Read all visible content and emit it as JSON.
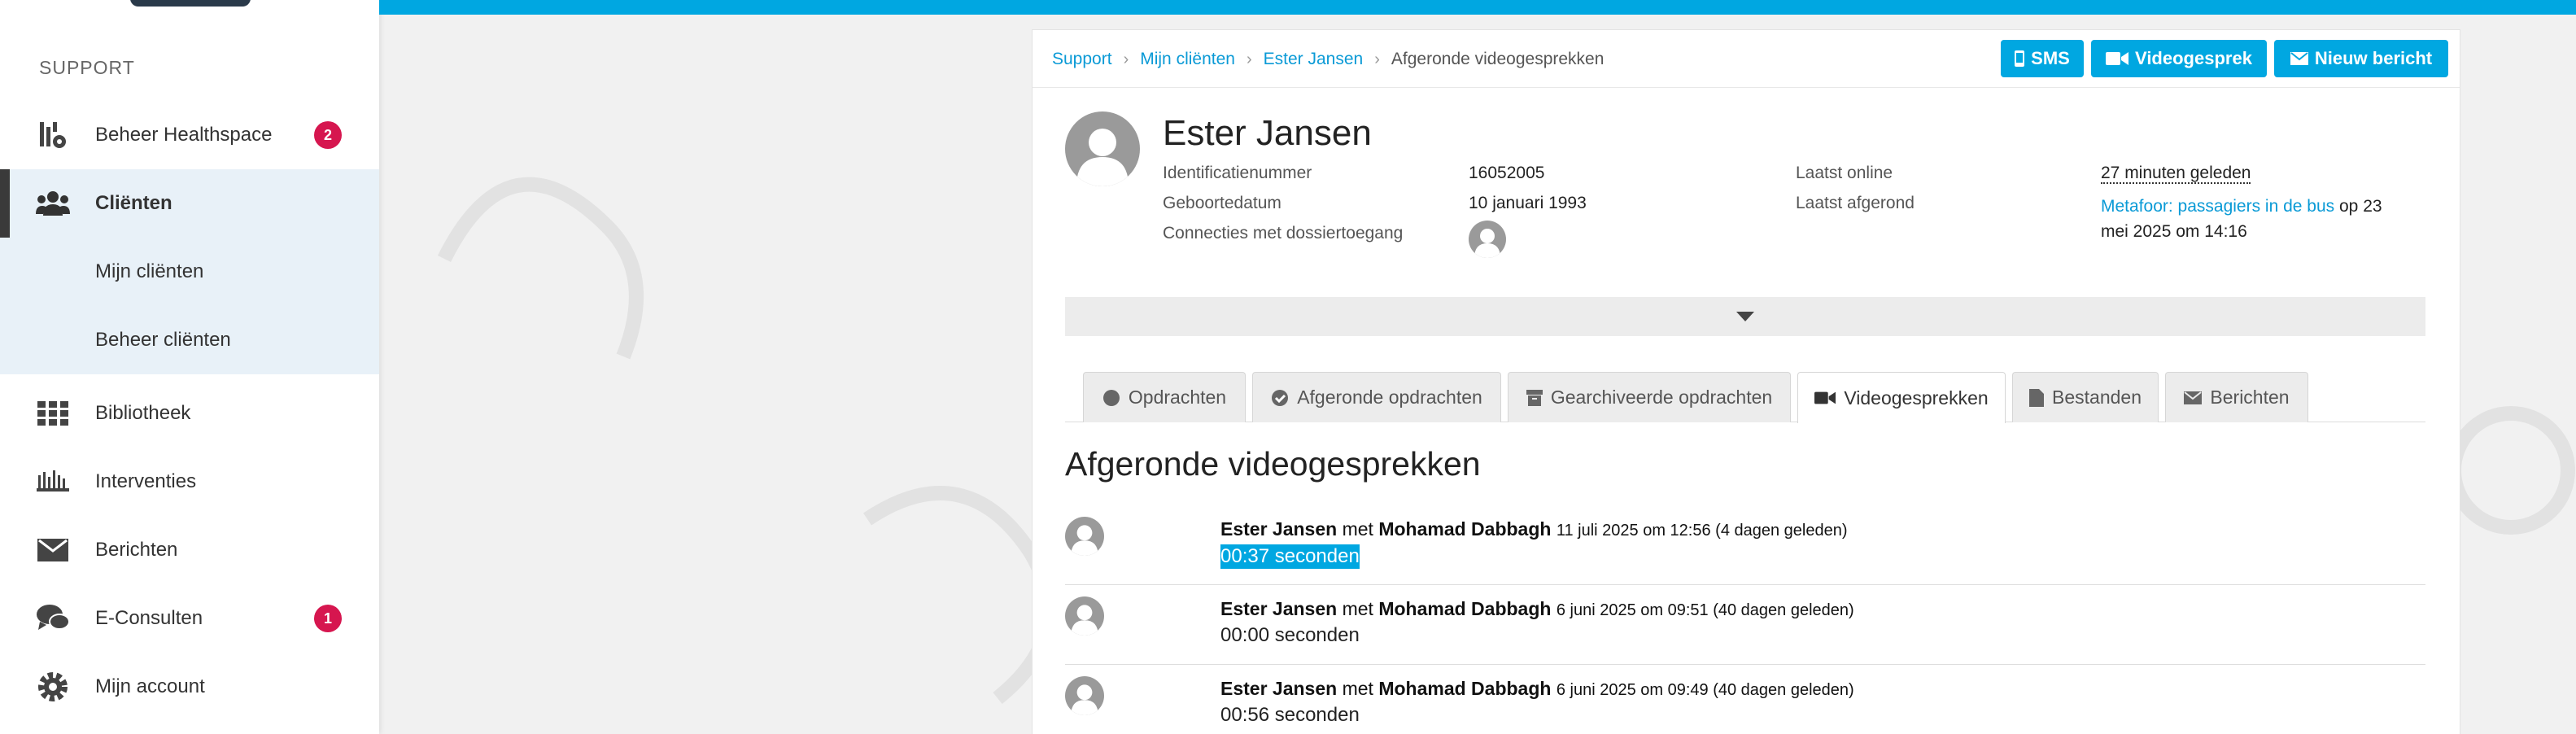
{
  "sidebar": {
    "heading": "SUPPORT",
    "items": [
      {
        "label": "Beheer Healthspace",
        "badge": "2"
      },
      {
        "label": "Cliënten"
      },
      {
        "label": "Bibliotheek"
      },
      {
        "label": "Interventies"
      },
      {
        "label": "Berichten"
      },
      {
        "label": "E-Consulten",
        "badge": "1"
      },
      {
        "label": "Mijn account"
      }
    ],
    "subitems": [
      {
        "label": "Mijn cliënten"
      },
      {
        "label": "Beheer cliënten"
      }
    ]
  },
  "breadcrumb": {
    "items": [
      "Support",
      "Mijn cliënten",
      "Ester Jansen"
    ],
    "current": "Afgeronde videogesprekken"
  },
  "actions": {
    "sms": "SMS",
    "video": "Videogesprek",
    "message": "Nieuw bericht"
  },
  "client": {
    "name": "Ester Jansen",
    "id_label": "Identificatienummer",
    "id_value": "16052005",
    "dob_label": "Geboortedatum",
    "dob_value": "10 januari 1993",
    "connections_label": "Connecties met dossiertoegang",
    "last_online_label": "Laatst online",
    "last_online_value": "27 minuten geleden",
    "last_done_label": "Laatst afgerond",
    "last_done_link": "Metafoor: passagiers in de bus",
    "last_done_rest1": " op 23",
    "last_done_rest2": "mei 2025 om 14:16"
  },
  "tabs": [
    {
      "label": "Opdrachten"
    },
    {
      "label": "Afgeronde opdrachten"
    },
    {
      "label": "Gearchiveerde opdrachten"
    },
    {
      "label": "Videogesprekken"
    },
    {
      "label": "Bestanden"
    },
    {
      "label": "Berichten"
    }
  ],
  "section_title": "Afgeronde videogesprekken",
  "calls": [
    {
      "client": "Ester Jansen",
      "with": "met",
      "counselor": "Mohamad Dabbagh",
      "when": "11 juli 2025 om 12:56 (4 dagen geleden)",
      "duration": "00:37 seconden"
    },
    {
      "client": "Ester Jansen",
      "with": "met",
      "counselor": "Mohamad Dabbagh",
      "when": "6 juni 2025 om 09:51 (40 dagen geleden)",
      "duration": "00:00 seconden"
    },
    {
      "client": "Ester Jansen",
      "with": "met",
      "counselor": "Mohamad Dabbagh",
      "when": "6 juni 2025 om 09:49 (40 dagen geleden)",
      "duration": "00:56 seconden"
    }
  ],
  "colors": {
    "accent": "#00a7e1",
    "badge": "#d6164f",
    "link": "#0a9ad6"
  }
}
